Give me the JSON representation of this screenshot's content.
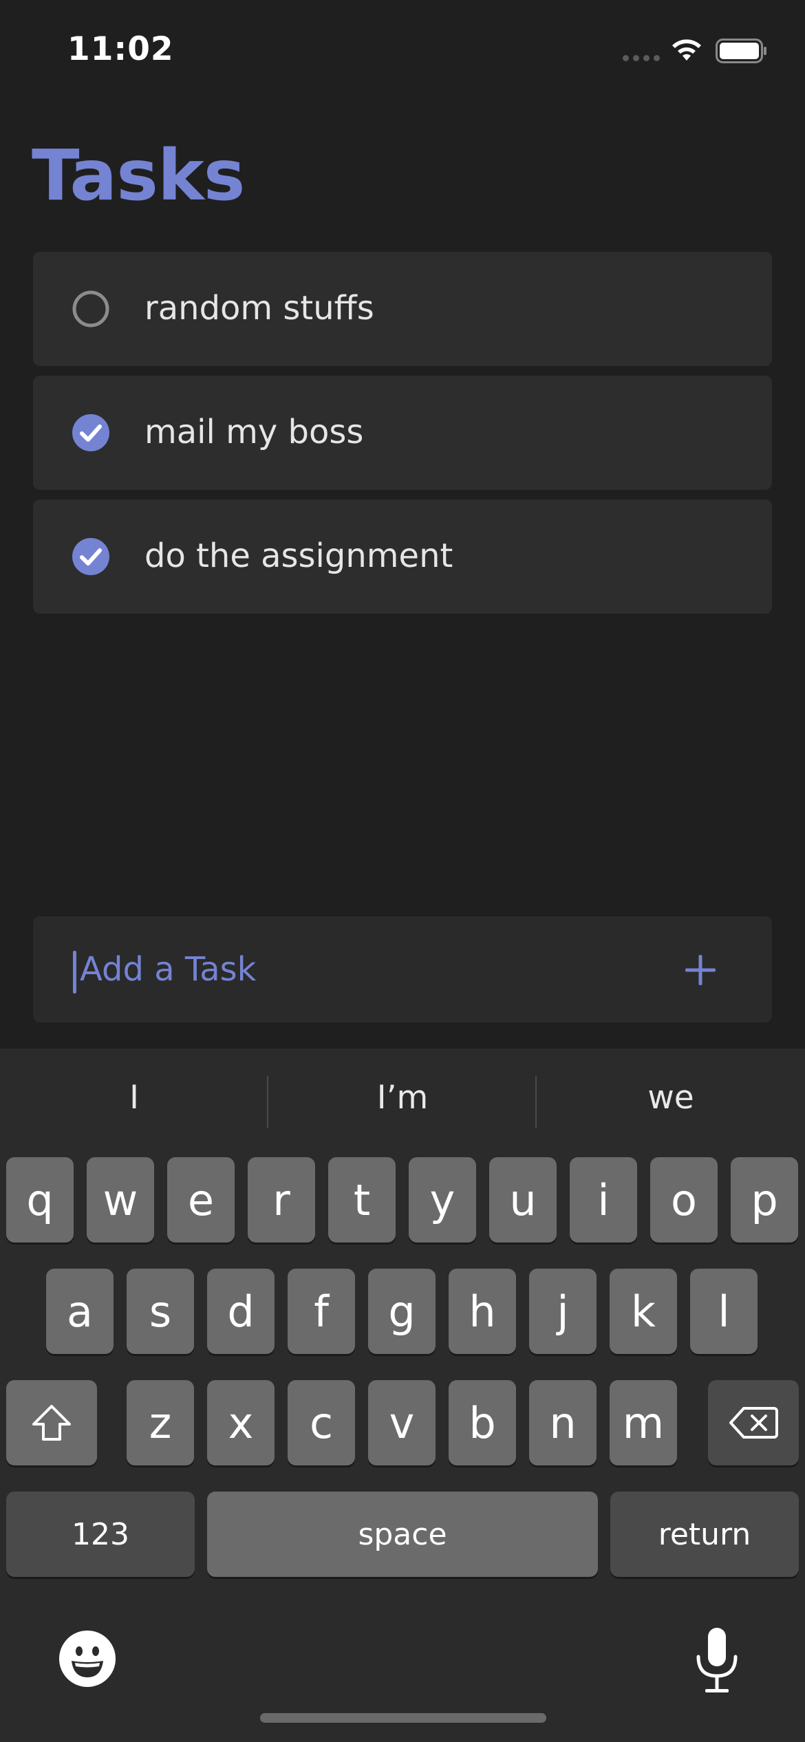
{
  "status_bar": {
    "time": "11:02"
  },
  "page_title": "Tasks",
  "colors": {
    "accent": "#7583d3",
    "background": "#1f1f1f",
    "card": "#2d2d2d"
  },
  "tasks": [
    {
      "label": "random stuffs",
      "done": false
    },
    {
      "label": "mail my boss",
      "done": true
    },
    {
      "label": "do the assignment",
      "done": true
    }
  ],
  "add_task": {
    "placeholder": "Add a Task",
    "value": ""
  },
  "keyboard": {
    "suggestions": [
      "I",
      "I’m",
      "we"
    ],
    "row1": [
      "q",
      "w",
      "e",
      "r",
      "t",
      "y",
      "u",
      "i",
      "o",
      "p"
    ],
    "row2": [
      "a",
      "s",
      "d",
      "f",
      "g",
      "h",
      "j",
      "k",
      "l"
    ],
    "row3": [
      "z",
      "x",
      "c",
      "v",
      "b",
      "n",
      "m"
    ],
    "numbers_label": "123",
    "space_label": "space",
    "return_label": "return"
  }
}
